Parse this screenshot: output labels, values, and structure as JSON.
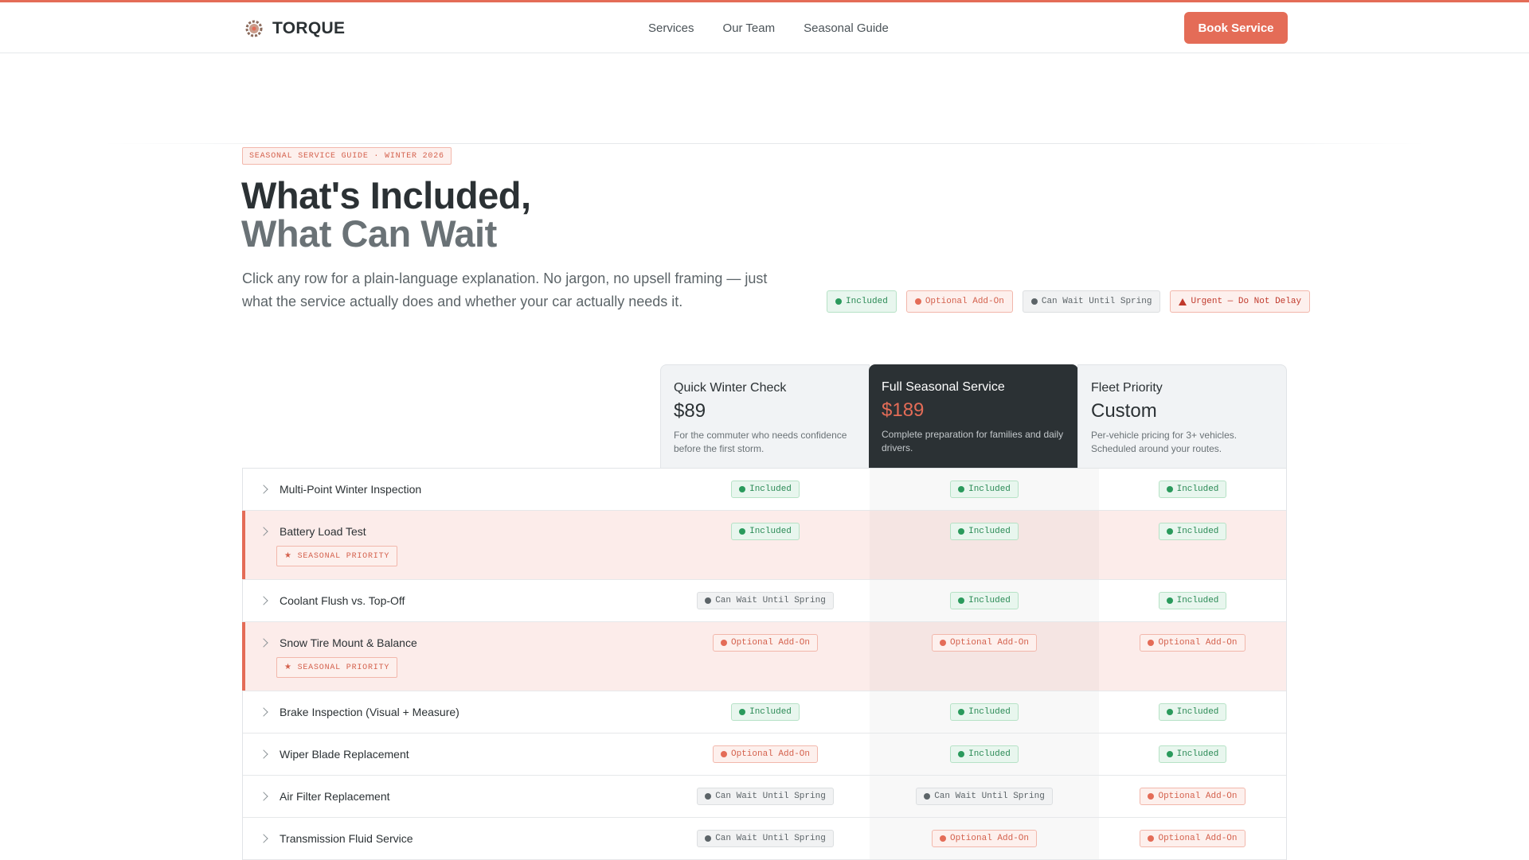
{
  "nav": {
    "brand": "TORQUE",
    "links": [
      "Services",
      "Our Team",
      "Seasonal Guide"
    ],
    "cta": "Book Service"
  },
  "hero": {
    "eyebrow": "SEASONAL SERVICE GUIDE · WINTER 2026",
    "title": "What's Included,",
    "subtitle": "What Can Wait",
    "description": "Click any row for a plain-language explanation. No jargon, no upsell framing — just what the service actually does and whether your car actually needs it."
  },
  "legend": {
    "included": "Included",
    "optional": "Optional Add-On",
    "wait": "Can Wait Until Spring",
    "urgent": "Urgent — Do Not Delay"
  },
  "plans": [
    {
      "name": "Quick Winter Check",
      "price": "$89",
      "description": "For the commuter who needs confidence before the first storm."
    },
    {
      "name": "Full Seasonal Service",
      "price": "$189",
      "description": "Complete preparation for families and daily drivers."
    },
    {
      "name": "Fleet Priority",
      "price": "Custom",
      "description": "Per-vehicle pricing for 3+ vehicles. Scheduled around your routes."
    }
  ],
  "priority_tag": "★ SEASONAL PRIORITY",
  "rows": [
    {
      "label": "Multi-Point Winter Inspection",
      "priority": false,
      "status": [
        "Included",
        "Included",
        "Included"
      ]
    },
    {
      "label": "Battery Load Test",
      "priority": true,
      "status": [
        "Included",
        "Included",
        "Included"
      ]
    },
    {
      "label": "Coolant Flush vs. Top-Off",
      "priority": false,
      "status": [
        "Can Wait Until Spring",
        "Included",
        "Included"
      ]
    },
    {
      "label": "Snow Tire Mount & Balance",
      "priority": true,
      "status": [
        "Optional Add-On",
        "Optional Add-On",
        "Optional Add-On"
      ]
    },
    {
      "label": "Brake Inspection (Visual + Measure)",
      "priority": false,
      "status": [
        "Included",
        "Included",
        "Included"
      ]
    },
    {
      "label": "Wiper Blade Replacement",
      "priority": false,
      "status": [
        "Optional Add-On",
        "Included",
        "Included"
      ]
    },
    {
      "label": "Air Filter Replacement",
      "priority": false,
      "status": [
        "Can Wait Until Spring",
        "Can Wait Until Spring",
        "Optional Add-On"
      ]
    },
    {
      "label": "Transmission Fluid Service",
      "priority": false,
      "status": [
        "Can Wait Until Spring",
        "Optional Add-On",
        "Optional Add-On"
      ]
    }
  ],
  "colors": {
    "accent": "#e46c57",
    "dark": "#2b3134",
    "included": "#2a9a5c",
    "wait": "#5c6468"
  }
}
